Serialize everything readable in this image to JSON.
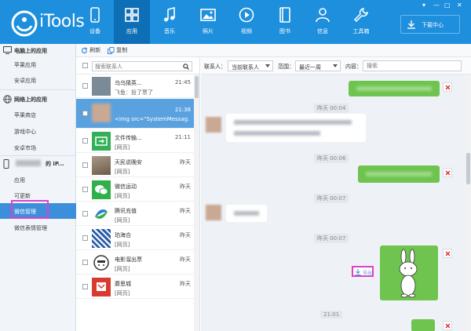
{
  "app": {
    "name": "iTools",
    "window_controls": [
      "▾",
      "—",
      "□",
      "✕"
    ]
  },
  "nav": {
    "tabs": [
      {
        "label": "设备",
        "icon": "phone-icon",
        "active": false
      },
      {
        "label": "应用",
        "icon": "apps-grid-icon",
        "active": true
      },
      {
        "label": "音乐",
        "icon": "music-note-icon",
        "active": false
      },
      {
        "label": "照片",
        "icon": "photo-icon",
        "active": false
      },
      {
        "label": "视频",
        "icon": "video-play-icon",
        "active": false
      },
      {
        "label": "图书",
        "icon": "book-icon",
        "active": false
      },
      {
        "label": "信息",
        "icon": "person-icon",
        "active": false
      },
      {
        "label": "工具箱",
        "icon": "wrench-icon",
        "active": false
      }
    ],
    "download_label": "下载中心"
  },
  "sidebar": {
    "section_pc": "电脑上的应用",
    "pc_items": [
      "苹果应用",
      "安卓应用"
    ],
    "section_net": "网络上的应用",
    "net_items": [
      "苹果商店",
      "游戏中心",
      "安卓市场"
    ],
    "device_suffix": "的 iP...",
    "device_items": [
      "应用",
      "可更新",
      "微信管理",
      "微信表情管理"
    ],
    "active_item": "微信管理"
  },
  "toolbar": {
    "refresh_label": "刷新",
    "copy_label": "复制"
  },
  "contacts": {
    "search_placeholder": "搜索联系人",
    "items": [
      {
        "name": "乌乌猜英...",
        "time": "21:45",
        "msg": "飞鱼：投了票了",
        "avatar_color": "#7a8a96"
      },
      {
        "name": "",
        "time": "21:38",
        "msg": "<img src=\"SystemMessag...",
        "avatar_color": "#c9a894"
      },
      {
        "name": "文件传输...",
        "time": "21:11",
        "msg": "[网页]",
        "avatar_color": "#31b057"
      },
      {
        "name": "天民说晚安",
        "time": "昨天",
        "msg": "[网页]",
        "avatar_color": "#7b6a58"
      },
      {
        "name": "微信运动",
        "time": "昨天",
        "msg": "[网页]",
        "avatar_color": "#2fb04b"
      },
      {
        "name": "腾讯充值",
        "time": "昨天",
        "msg": "[网页]",
        "avatar_color": "#2a7fcf"
      },
      {
        "name": "珀海合",
        "time": "昨天",
        "msg": "[网页]",
        "avatar_color": "#2b5ea8"
      },
      {
        "name": "电影溜出票",
        "time": "昨天",
        "msg": "[网页]",
        "avatar_color": "#333333"
      },
      {
        "name": "蘑思城",
        "time": "昨天",
        "msg": "[网页]",
        "avatar_color": "#d93a2f"
      }
    ]
  },
  "filter": {
    "contact_label": "联系人：",
    "contact_value": "当前联系人",
    "range_label": "范围：",
    "range_value": "最近一周",
    "content_label": "内容：",
    "content_placeholder": "搜索"
  },
  "chat": {
    "timestamps": [
      "昨天 00:04",
      "昨天 00:06",
      "昨天 00:07",
      "昨天 00:07",
      "21:01"
    ],
    "export_label": "导出"
  },
  "colors": {
    "header": "#1e8fdc",
    "active_tab": "#0e6fb7",
    "sidebar_active": "#3d8fdb",
    "contact_selected": "#5aa1e0",
    "bubble_green": "#6ec44f",
    "highlight": "#e040c8"
  }
}
